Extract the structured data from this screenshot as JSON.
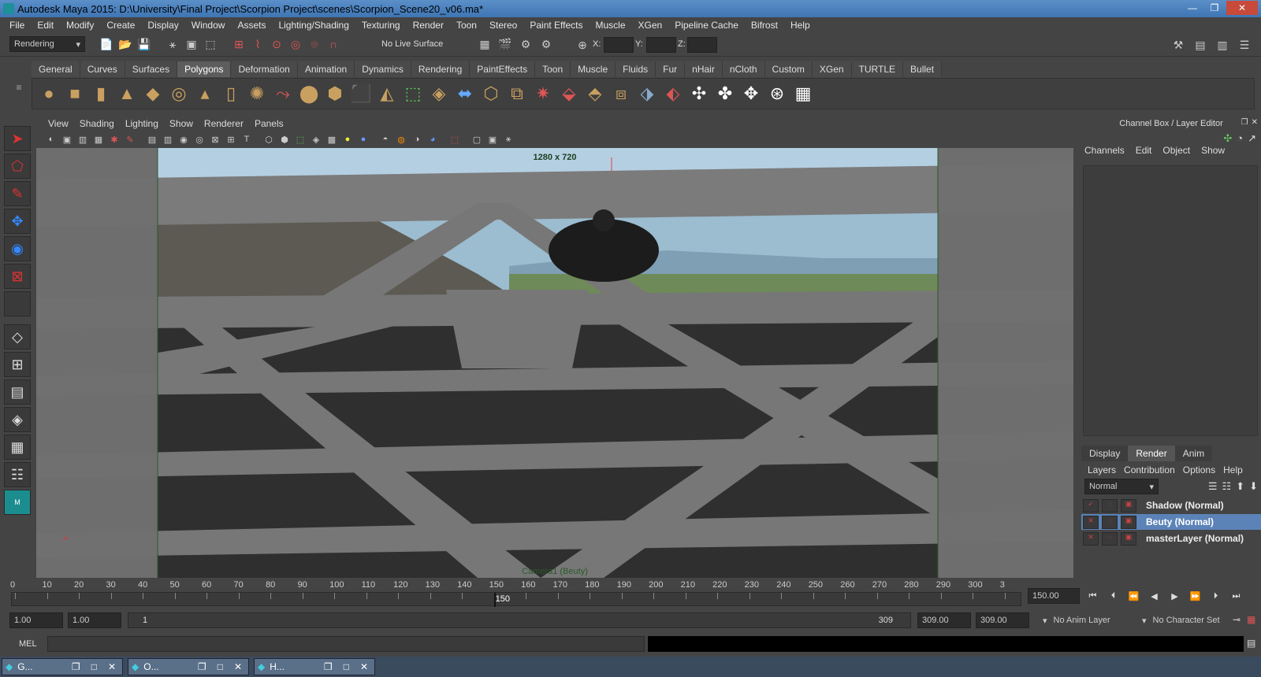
{
  "window": {
    "title": "Autodesk Maya 2015: D:\\University\\Final Project\\Scorpion Project\\scenes\\Scorpion_Scene20_v06.ma*",
    "btn_min": "—",
    "btn_max": "❐",
    "btn_close": "✕"
  },
  "menubar": [
    "File",
    "Edit",
    "Modify",
    "Create",
    "Display",
    "Window",
    "Assets",
    "Lighting/Shading",
    "Texturing",
    "Render",
    "Toon",
    "Stereo",
    "Paint Effects",
    "Muscle",
    "XGen",
    "Pipeline Cache",
    "Bifrost",
    "Help"
  ],
  "statusline": {
    "menuset": "Rendering",
    "live_surface": "No Live Surface",
    "x_label": "X:",
    "y_label": "Y:",
    "z_label": "Z:"
  },
  "shelf": {
    "tabs": [
      "General",
      "Curves",
      "Surfaces",
      "Polygons",
      "Deformation",
      "Animation",
      "Dynamics",
      "Rendering",
      "PaintEffects",
      "Toon",
      "Muscle",
      "Fluids",
      "Fur",
      "nHair",
      "nCloth",
      "Custom",
      "XGen",
      "TURTLE",
      "Bullet"
    ],
    "active_tab": "Polygons"
  },
  "panel": {
    "menus": [
      "View",
      "Shading",
      "Lighting",
      "Show",
      "Renderer",
      "Panels"
    ],
    "resolution": "1280 x 720",
    "camera_label": "Camera1 (Beuty)"
  },
  "channelbox": {
    "title": "Channel Box / Layer Editor",
    "menus": [
      "Channels",
      "Edit",
      "Object",
      "Show"
    ]
  },
  "layereditor": {
    "tabs": [
      "Display",
      "Render",
      "Anim"
    ],
    "active_tab": "Render",
    "menus": [
      "Layers",
      "Contribution",
      "Options",
      "Help"
    ],
    "blend_mode": "Normal",
    "layers": [
      {
        "name": "Shadow (Normal)",
        "selected": false
      },
      {
        "name": "Beuty (Normal)",
        "selected": true
      },
      {
        "name": "masterLayer (Normal)",
        "selected": false
      }
    ]
  },
  "timeline": {
    "ticks": [
      "0",
      "10",
      "20",
      "30",
      "40",
      "50",
      "60",
      "70",
      "80",
      "90",
      "100",
      "110",
      "120",
      "130",
      "140",
      "150",
      "160",
      "170",
      "180",
      "190",
      "200",
      "210",
      "220",
      "230",
      "240",
      "250",
      "260",
      "270",
      "280",
      "290",
      "300",
      "3"
    ],
    "current_frame": "150",
    "end_field": "150.00"
  },
  "range": {
    "start": "1.00",
    "start2": "1.00",
    "slider_start": "1",
    "slider_end": "309",
    "end": "309.00",
    "end2": "309.00",
    "anim_layer": "No Anim Layer",
    "char_set": "No Character Set"
  },
  "cmd": {
    "label": "MEL"
  },
  "taskbar": [
    {
      "label": "G..."
    },
    {
      "label": "O..."
    },
    {
      "label": "H..."
    }
  ],
  "colors": {
    "accent": "#5b83b8",
    "titlebar": "#4a80bd",
    "sky": "#a9c7db",
    "gate": "#777777",
    "gap": "#2e2e2e"
  }
}
